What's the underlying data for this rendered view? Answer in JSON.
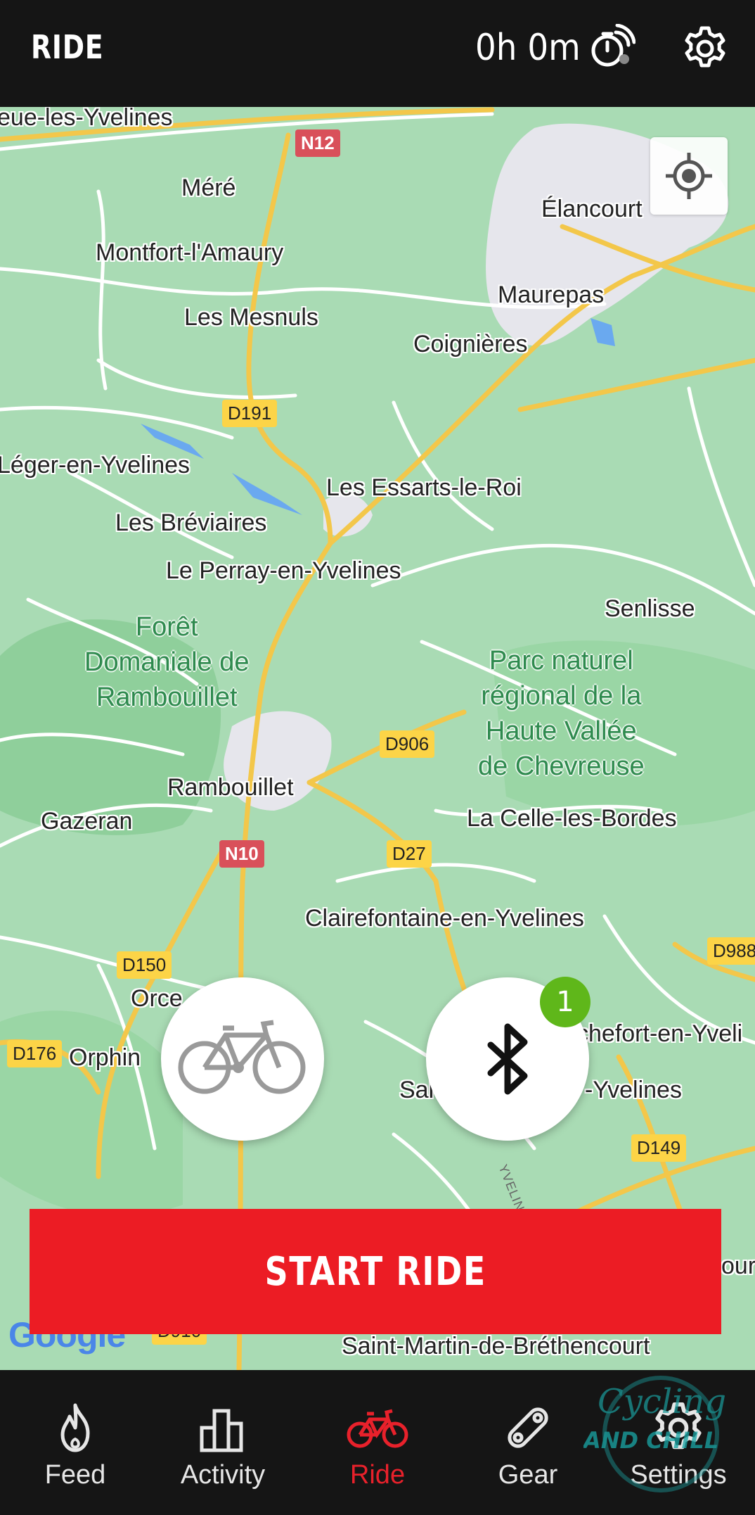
{
  "header": {
    "title": "RIDE",
    "timer": "0h 0m",
    "timer_icon": "stopwatch-satellite-icon",
    "settings_icon": "gear-icon"
  },
  "map": {
    "places": [
      {
        "label": "eue-les-Yvelines"
      },
      {
        "label": "Méré"
      },
      {
        "label": "Élancourt"
      },
      {
        "label": "Montfort-l'Amaury"
      },
      {
        "label": "Maurepas"
      },
      {
        "label": "Les Mesnuls"
      },
      {
        "label": "Coignières"
      },
      {
        "label": "Léger-en-Yvelines"
      },
      {
        "label": "Les Essarts-le-Roi"
      },
      {
        "label": "Les Bréviaires"
      },
      {
        "label": "Le Perray-en-Yvelines"
      },
      {
        "label": "Senlisse"
      },
      {
        "label": "Rambouillet"
      },
      {
        "label": "Gazeran"
      },
      {
        "label": "La Celle-les-Bordes"
      },
      {
        "label": "Clairefontaine-en-Yvelines"
      },
      {
        "label": "Orce"
      },
      {
        "label": "chefort-en-Yveli"
      },
      {
        "label": "Orphin"
      },
      {
        "label": "Sai"
      },
      {
        "label": "-Yvelines"
      },
      {
        "label": "Saint-Martin-de-Bréthencourt"
      },
      {
        "label": "ourc"
      }
    ],
    "parks": [
      {
        "label": "Forêt\nDomaniale de\nRambouillet"
      },
      {
        "label": "Parc naturel\nrégional de la\nHaute Vallée\nde Chevreuse"
      }
    ],
    "road_shields": [
      {
        "label": "N12",
        "kind": "national"
      },
      {
        "label": "D191",
        "kind": "departmental"
      },
      {
        "label": "D906",
        "kind": "departmental"
      },
      {
        "label": "N10",
        "kind": "national"
      },
      {
        "label": "D27",
        "kind": "departmental"
      },
      {
        "label": "D150",
        "kind": "departmental"
      },
      {
        "label": "D988",
        "kind": "departmental"
      },
      {
        "label": "D176",
        "kind": "departmental"
      },
      {
        "label": "D149",
        "kind": "departmental"
      },
      {
        "label": "D910",
        "kind": "departmental"
      }
    ],
    "road_label": "YVELINES",
    "attribution": "Google",
    "colors": {
      "land": "#a9dbb4",
      "forest": "#8fcf9b",
      "urban": "#e4e4ea",
      "road_major": "#fcd447",
      "road_minor": "#ffffff",
      "water": "#6aa9ef"
    }
  },
  "controls": {
    "bike_button_icon": "road-bike-icon",
    "bluetooth_button_icon": "bluetooth-icon",
    "bluetooth_badge_count": "1",
    "locate_icon": "my-location-icon",
    "start_label": "START RIDE"
  },
  "nav": {
    "items": [
      {
        "label": "Feed",
        "icon": "flame-icon"
      },
      {
        "label": "Activity",
        "icon": "bar-chart-icon"
      },
      {
        "label": "Ride",
        "icon": "bike-icon",
        "active": true
      },
      {
        "label": "Gear",
        "icon": "chain-link-icon"
      },
      {
        "label": "Settings",
        "icon": "gear-icon"
      }
    ]
  },
  "watermark": {
    "line1": "Cycling",
    "line2": "AND CHILL"
  },
  "colors": {
    "accent": "#ec1c24",
    "header_bg": "#151515",
    "badge": "#5fb71a"
  }
}
